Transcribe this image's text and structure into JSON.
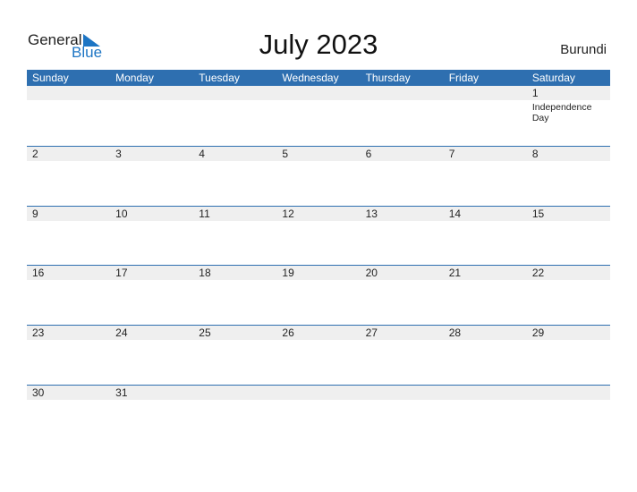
{
  "logo": {
    "general": "General",
    "blue": "Blue"
  },
  "title": "July 2023",
  "country": "Burundi",
  "colors": {
    "accent": "#2e6fb0",
    "logo_blue": "#1d75c4",
    "date_bg": "#efefef"
  },
  "weekdays": [
    "Sunday",
    "Monday",
    "Tuesday",
    "Wednesday",
    "Thursday",
    "Friday",
    "Saturday"
  ],
  "weeks": [
    [
      {
        "d": ""
      },
      {
        "d": ""
      },
      {
        "d": ""
      },
      {
        "d": ""
      },
      {
        "d": ""
      },
      {
        "d": ""
      },
      {
        "d": "1",
        "h": "Independence Day"
      }
    ],
    [
      {
        "d": "2"
      },
      {
        "d": "3"
      },
      {
        "d": "4"
      },
      {
        "d": "5"
      },
      {
        "d": "6"
      },
      {
        "d": "7"
      },
      {
        "d": "8"
      }
    ],
    [
      {
        "d": "9"
      },
      {
        "d": "10"
      },
      {
        "d": "11"
      },
      {
        "d": "12"
      },
      {
        "d": "13"
      },
      {
        "d": "14"
      },
      {
        "d": "15"
      }
    ],
    [
      {
        "d": "16"
      },
      {
        "d": "17"
      },
      {
        "d": "18"
      },
      {
        "d": "19"
      },
      {
        "d": "20"
      },
      {
        "d": "21"
      },
      {
        "d": "22"
      }
    ],
    [
      {
        "d": "23"
      },
      {
        "d": "24"
      },
      {
        "d": "25"
      },
      {
        "d": "26"
      },
      {
        "d": "27"
      },
      {
        "d": "28"
      },
      {
        "d": "29"
      }
    ],
    [
      {
        "d": "30"
      },
      {
        "d": "31"
      },
      {
        "d": ""
      },
      {
        "d": ""
      },
      {
        "d": ""
      },
      {
        "d": ""
      },
      {
        "d": ""
      }
    ]
  ]
}
